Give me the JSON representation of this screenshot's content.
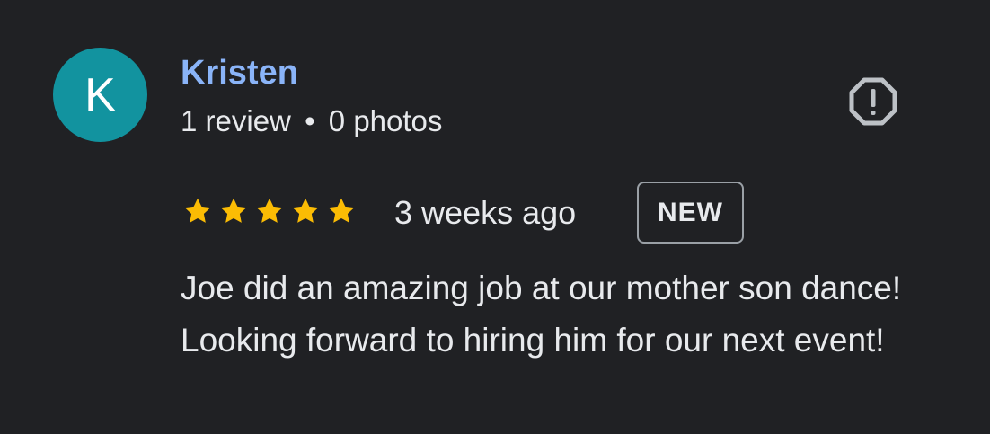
{
  "review": {
    "avatar_initial": "K",
    "avatar_color": "#12939f",
    "author_name": "Kristen",
    "author_name_color": "#8ab4f8",
    "review_count": "1 review",
    "separator": "•",
    "photo_count": "0 photos",
    "rating": 5,
    "max_rating": 5,
    "star_color": "#fbbc04",
    "time_ago": "3 weeks ago",
    "badge": "NEW",
    "text": "Joe did an amazing job at our mother son dance! Looking forward to hiring him for our next event!",
    "report_icon": "report-flag-octagon-icon"
  }
}
